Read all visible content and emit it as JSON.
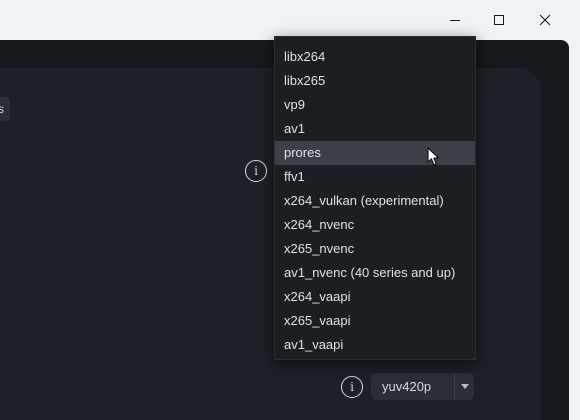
{
  "window": {
    "controls": {
      "minimize_icon": "minimize-icon",
      "maximize_icon": "maximize-icon",
      "close_icon": "close-icon"
    }
  },
  "left_chip": {
    "label": "s"
  },
  "codec_dropdown": {
    "options": [
      "libx264",
      "libx265",
      "vp9",
      "av1",
      "prores",
      "ffv1",
      "x264_vulkan (experimental)",
      "x264_nvenc",
      "x265_nvenc",
      "av1_nvenc (40 series and up)",
      "x264_vaapi",
      "x265_vaapi",
      "av1_vaapi"
    ],
    "hovered": "prores"
  },
  "info_icon": {
    "glyph": "i"
  },
  "pixel_format": {
    "value": "yuv420p"
  },
  "colors": {
    "background": "#16191d",
    "panel": "#1d2026",
    "dropdown_bg": "#1b1e23",
    "hover": "#3a3f48",
    "text": "#dfe2e6"
  }
}
